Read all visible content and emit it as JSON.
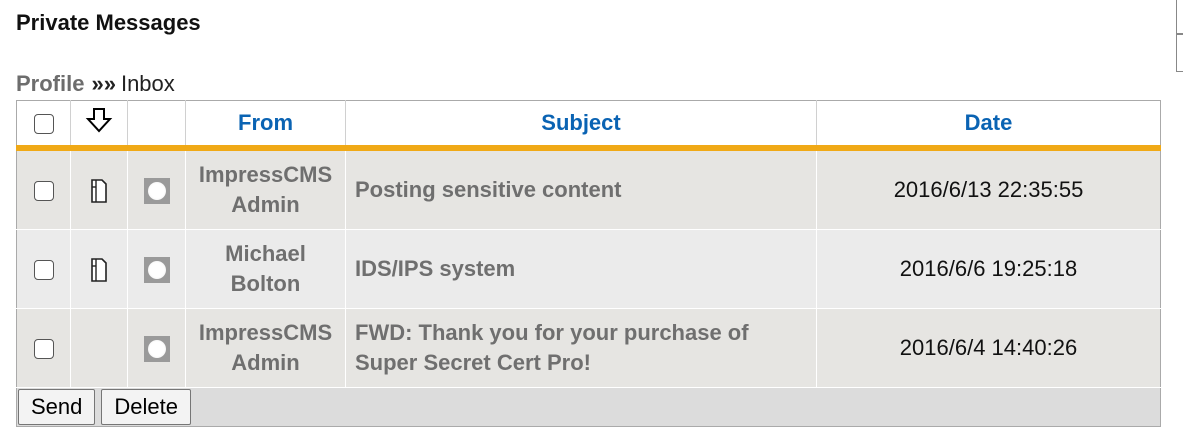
{
  "page": {
    "title": "Private Messages"
  },
  "breadcrumb": {
    "profile_label": "Profile",
    "separator": "»»",
    "current": "Inbox"
  },
  "table": {
    "columns": {
      "from": "From",
      "subject": "Subject",
      "date": "Date"
    },
    "icons": {
      "sort": "arrow-down-icon",
      "unread": "document-icon",
      "status": "message-status-icon"
    },
    "rows": [
      {
        "from_line1": "ImpressCMS",
        "from_line2": "Admin",
        "subject": "Posting sensitive content",
        "date": "2016/6/13 22:35:55",
        "has_doc_icon": true
      },
      {
        "from_line1": "Michael",
        "from_line2": "Bolton",
        "subject": "IDS/IPS system",
        "date": "2016/6/6 19:25:18",
        "has_doc_icon": true
      },
      {
        "from_line1": "ImpressCMS",
        "from_line2": "Admin",
        "subject": "FWD: Thank you for your purchase of Super Secret Cert Pro!",
        "date": "2016/6/4 14:40:26",
        "has_doc_icon": false
      }
    ]
  },
  "actions": {
    "send_label": "Send",
    "delete_label": "Delete"
  },
  "colors": {
    "header_text": "#0a63b3",
    "header_rule": "#f0a916",
    "row_text": "#6f6f6f"
  }
}
